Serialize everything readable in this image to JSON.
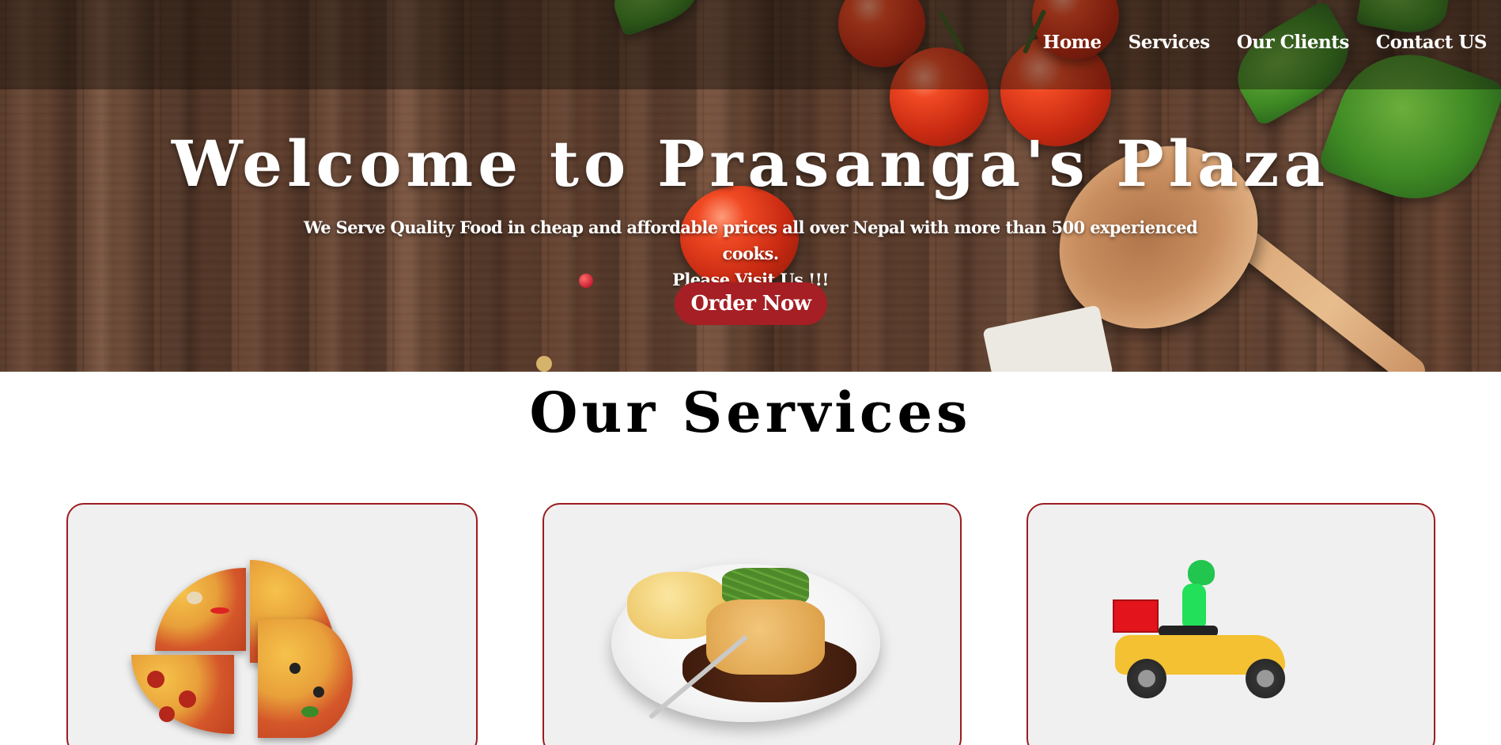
{
  "nav": {
    "items": [
      {
        "label": "Home"
      },
      {
        "label": "Services"
      },
      {
        "label": "Our Clients"
      },
      {
        "label": "Contact US"
      }
    ]
  },
  "hero": {
    "title": "Welcome to Prasanga's Plaza",
    "subtitle_line1": "We Serve Quality Food in cheap and affordable prices all over Nepal with more than 500 experienced cooks.",
    "subtitle_line2": "Please Visit Us !!!",
    "cta_label": "Order Now"
  },
  "services": {
    "title": "Our Services",
    "cards": [
      {
        "image": "pizza-image"
      },
      {
        "image": "dish-image"
      },
      {
        "image": "delivery-scooter-image"
      }
    ]
  },
  "colors": {
    "accent": "#a51f24",
    "card_border": "#9b1c1f",
    "card_bg": "#f0f0f0"
  }
}
